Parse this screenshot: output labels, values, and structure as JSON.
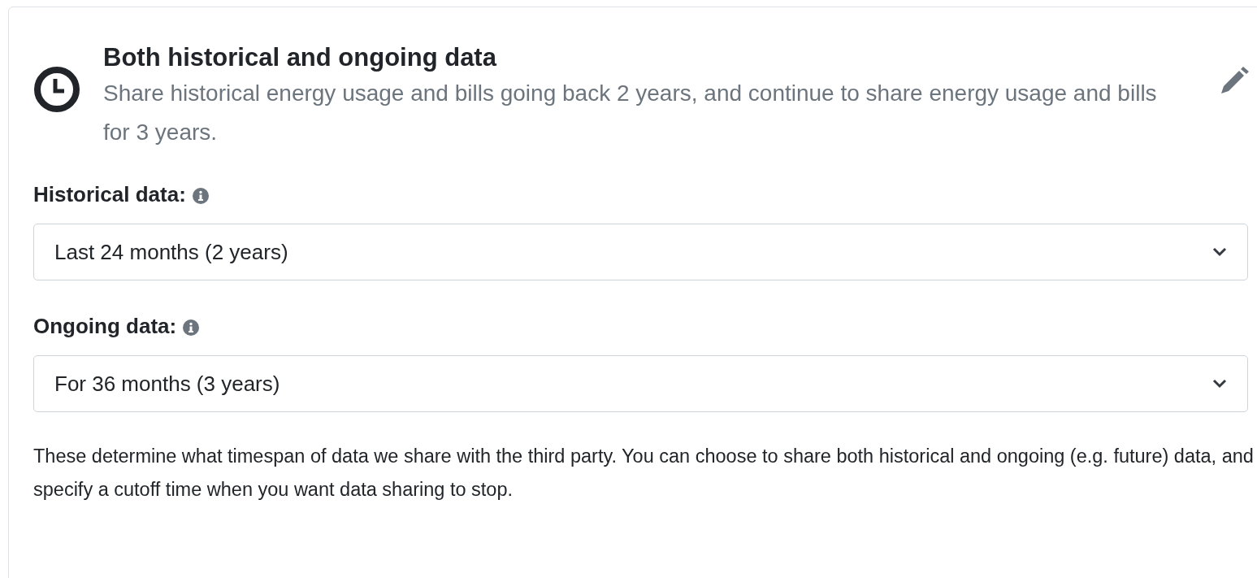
{
  "option": {
    "title": "Both historical and ongoing data",
    "description": "Share historical energy usage and bills going back 2 years, and continue to share energy usage and bills for 3 years."
  },
  "fields": [
    {
      "label": "Historical data:",
      "value": "Last 24 months (2 years)"
    },
    {
      "label": "Ongoing data:",
      "value": "For 36 months (3 years)"
    }
  ],
  "help_text": "These determine what timespan of data we share with the third party. You can choose to share both historical and ongoing (e.g. future) data, and specify a cutoff time when you want data sharing to stop."
}
